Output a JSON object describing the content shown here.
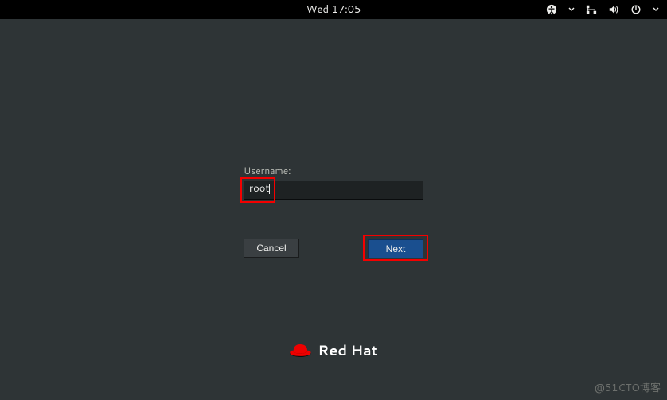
{
  "topbar": {
    "clock": "Wed 17:05"
  },
  "login": {
    "username_label": "Username:",
    "username_value": "root",
    "cancel_label": "Cancel",
    "next_label": "Next"
  },
  "brand": {
    "name": "Red Hat"
  },
  "watermark": "@51CTO博客",
  "icons": {
    "accessibility": "accessibility-icon",
    "network": "network-icon",
    "volume": "volume-icon",
    "power": "power-icon",
    "dropdown": "chevron-down-icon"
  }
}
